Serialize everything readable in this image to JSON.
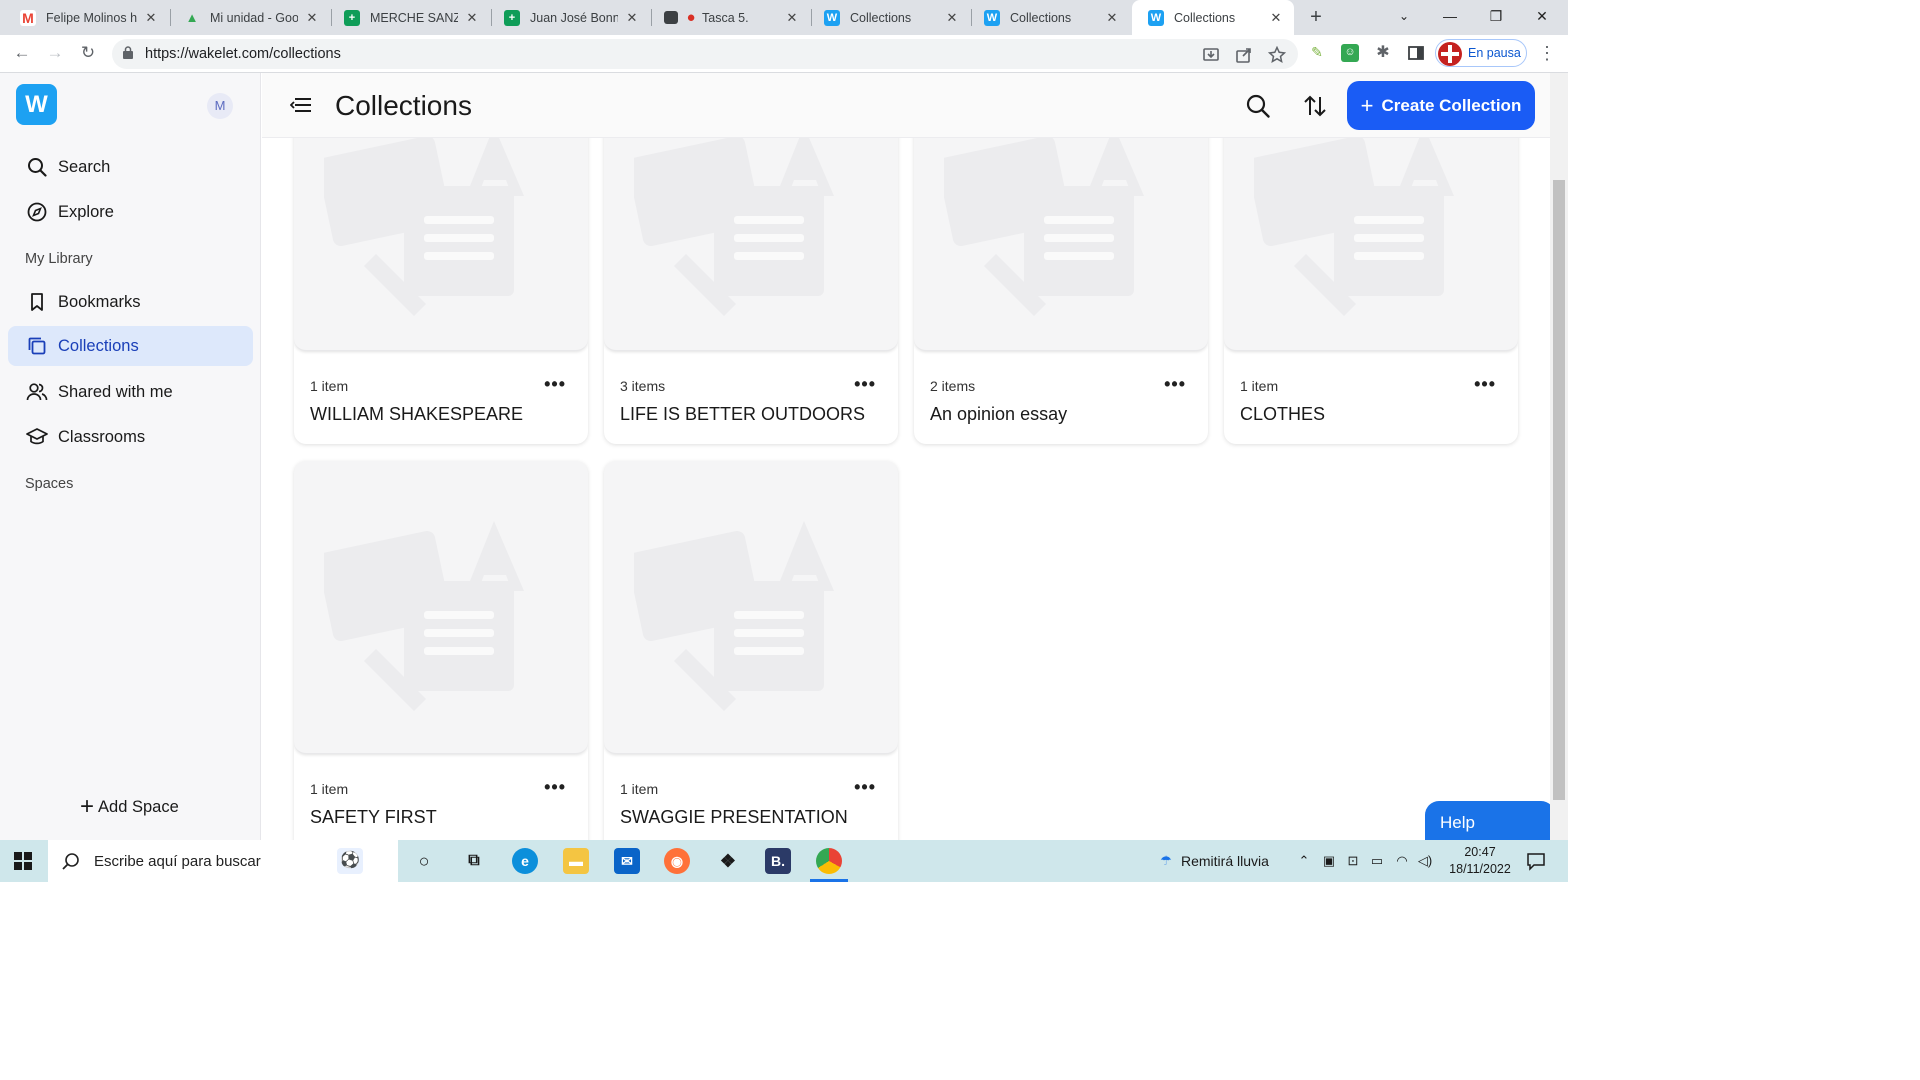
{
  "browser": {
    "tabs": [
      {
        "title": "Felipe Molinos ha",
        "favicon": "gmail-icon",
        "color": "#ea4335",
        "glyph": "M"
      },
      {
        "title": "Mi unidad - Goog",
        "favicon": "google-drive-icon",
        "color": "#fbbc04",
        "glyph": "▲"
      },
      {
        "title": "MERCHE SANZ O",
        "favicon": "sheets-icon",
        "color": "#0f9d58",
        "glyph": "+"
      },
      {
        "title": "Juan José Bonnín",
        "favicon": "sheets-icon",
        "color": "#0f9d58",
        "glyph": "+"
      },
      {
        "title": "Tasca 5.",
        "favicon": "recording-icon",
        "color": "#d93025",
        "glyph": "●"
      },
      {
        "title": "Collections",
        "favicon": "wakelet-icon",
        "color": "#1da1f2",
        "glyph": "W"
      },
      {
        "title": "Collections",
        "favicon": "wakelet-icon",
        "color": "#1da1f2",
        "glyph": "W"
      },
      {
        "title": "Collections",
        "favicon": "wakelet-icon",
        "color": "#1da1f2",
        "glyph": "W"
      }
    ],
    "url": "https://wakelet.com/collections",
    "profile_status": "En pausa"
  },
  "sidebar": {
    "logo": "W",
    "user_initial": "M",
    "top_items": [
      {
        "label": "Search",
        "icon": "search-icon"
      },
      {
        "label": "Explore",
        "icon": "compass-icon"
      }
    ],
    "library_label": "My Library",
    "library_items": [
      {
        "label": "Bookmarks",
        "icon": "bookmark-icon"
      },
      {
        "label": "Collections",
        "icon": "collections-icon",
        "active": true
      },
      {
        "label": "Shared with me",
        "icon": "people-icon"
      },
      {
        "label": "Classrooms",
        "icon": "graduation-cap-icon"
      }
    ],
    "spaces_label": "Spaces",
    "add_space": "Add Space"
  },
  "header": {
    "title": "Collections",
    "create_label": "Create Collection"
  },
  "collections": [
    {
      "count": "1 item",
      "name": "WILLIAM SHAKESPEARE"
    },
    {
      "count": "3 items",
      "name": "LIFE IS BETTER OUTDOORS"
    },
    {
      "count": "2 items",
      "name": "An opinion essay"
    },
    {
      "count": "1 item",
      "name": "CLOTHES"
    },
    {
      "count": "1 item",
      "name": "SAFETY FIRST"
    },
    {
      "count": "1 item",
      "name": "SWAGGIE PRESENTATION"
    }
  ],
  "more_glyph": "•••",
  "help_label": "Help",
  "taskbar": {
    "search_placeholder": "Escribe aquí para buscar",
    "weather": "Remitirá lluvia",
    "time": "20:47",
    "date": "18/11/2022"
  },
  "colors": {
    "accent": "#1a5cf5",
    "active_nav_bg": "#dde8fb",
    "brand": "#1da1f2"
  }
}
